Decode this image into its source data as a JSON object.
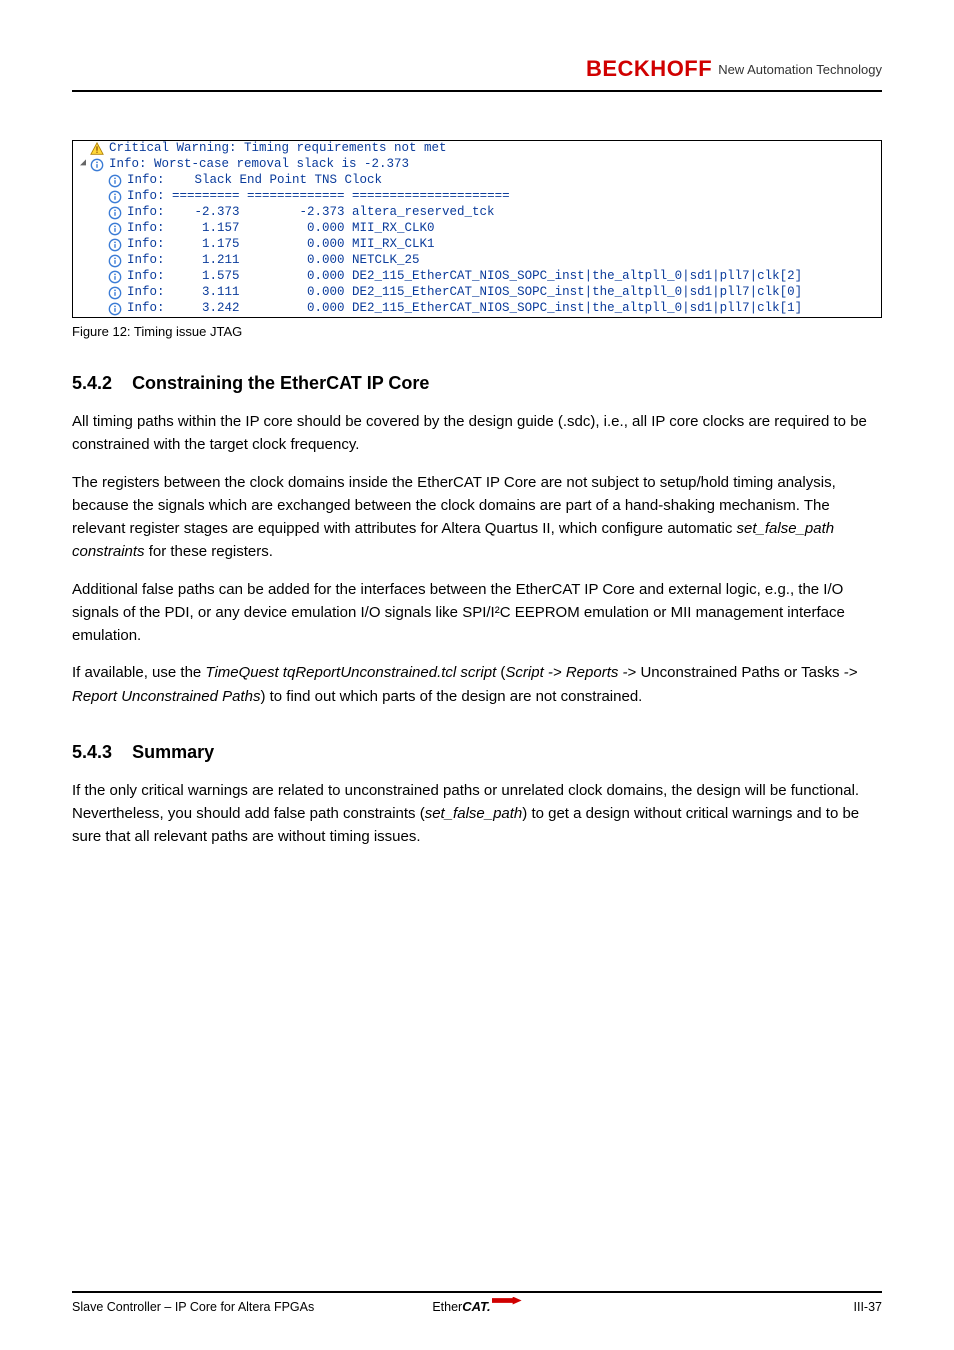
{
  "header": {
    "brand": "BECKHOFF",
    "tag": "New Automation Technology"
  },
  "figure": {
    "caption": "Figure 12: Timing issue JTAG",
    "number": 12
  },
  "log": {
    "warning": "Critical Warning: Timing requirements not met",
    "summary": "Info: Worst-case removal slack is -2.373",
    "header_line": "Slack End Point TNS Clock",
    "separator": "========= ============= =====================",
    "rows": [
      {
        "slack": "-2.373",
        "tns": "-2.373",
        "clock": "altera_reserved_tck"
      },
      {
        "slack": "1.157",
        "tns": "0.000",
        "clock": "MII_RX_CLK0"
      },
      {
        "slack": "1.175",
        "tns": "0.000",
        "clock": "MII_RX_CLK1"
      },
      {
        "slack": "1.211",
        "tns": "0.000",
        "clock": "NETCLK_25"
      },
      {
        "slack": "1.575",
        "tns": "0.000",
        "clock": "DE2_115_EtherCAT_NIOS_SOPC_inst|the_altpll_0|sd1|pll7|clk[2]"
      },
      {
        "slack": "3.111",
        "tns": "0.000",
        "clock": "DE2_115_EtherCAT_NIOS_SOPC_inst|the_altpll_0|sd1|pll7|clk[0]"
      },
      {
        "slack": "3.242",
        "tns": "0.000",
        "clock": "DE2_115_EtherCAT_NIOS_SOPC_inst|the_altpll_0|sd1|pll7|clk[1]"
      }
    ]
  },
  "section": {
    "num": "5.4.2",
    "title": "Constraining the EtherCAT IP Core",
    "p1": "All timing paths within the IP core should be covered by the design guide (.sdc), i.e., all IP core clocks are required to be constrained with the target clock frequency.",
    "p2_a": "The registers between the clock domains inside the EtherCAT IP Core are not subject to setup/hold timing analysis, because the signals which are exchanged between the clock domains are part of a hand-shaking mechanism. The relevant register stages are equipped with attributes for Altera Quartus II, which configure automatic ",
    "p2_i": "set_false_path constraints",
    "p2_b": " for these registers.",
    "p3": "Additional false paths can be added for the interfaces between the EtherCAT IP Core and external logic, e.g., the I/O signals of the PDI, or any device emulation I/O signals like SPI/I²C EEPROM emulation or MII management interface emulation.",
    "p4a": "If available, use the ",
    "p4b": "TimeQuest tqReportUnconstrained.tcl script",
    "p4c": " (",
    "p4d": "Script -> Reports -",
    "p4e": "> Unconstrained Paths or Tasks ",
    "p4f": "-> Report Unconstrained Paths",
    "p4g": ") to find out which parts of the design are not constrained."
  },
  "summary": {
    "num": "5.4.3",
    "title": "Summary",
    "p_a": "If the only critical warnings are related to unconstrained paths or unrelated clock domains, the design will be functional. Nevertheless, you should add false path constraints (",
    "p_i": "set_false_path",
    "p_b": ") to get a design without critical warnings and to be sure that all relevant paths are without timing issues."
  },
  "footer": {
    "left": "Slave Controller – IP Core for Altera FPGAs",
    "right": "III-37"
  },
  "ethercat": {
    "e": "Ether",
    "cat": "CAT."
  }
}
